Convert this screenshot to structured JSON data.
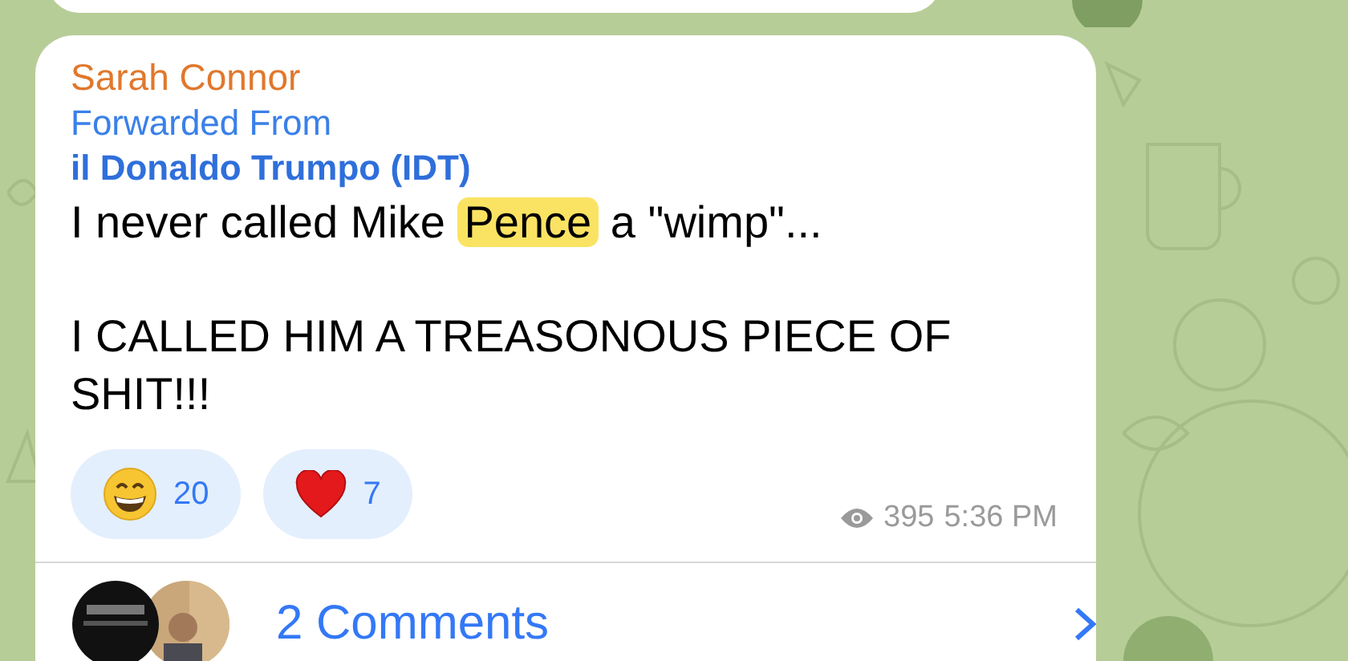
{
  "message": {
    "sender": "Sarah Connor",
    "forwarded_label": "Forwarded From",
    "forwarded_from": "il Donaldo Trumpo (IDT)",
    "lines": [
      [
        {
          "text": "I never called Mike ",
          "highlighted": false
        },
        {
          "text": "Pence",
          "highlighted": true
        },
        {
          "text": " a \"wimp\"...",
          "highlighted": false
        }
      ],
      [
        {
          "text": "I CALLED HIM A TREASONOUS PIECE OF SHIT!!!",
          "highlighted": false
        }
      ]
    ],
    "reactions": [
      {
        "kind": "grin",
        "count": "20"
      },
      {
        "kind": "heart",
        "count": "7"
      }
    ],
    "views": "395",
    "time": "5:36 PM",
    "comments": {
      "label": "2 Comments"
    }
  }
}
